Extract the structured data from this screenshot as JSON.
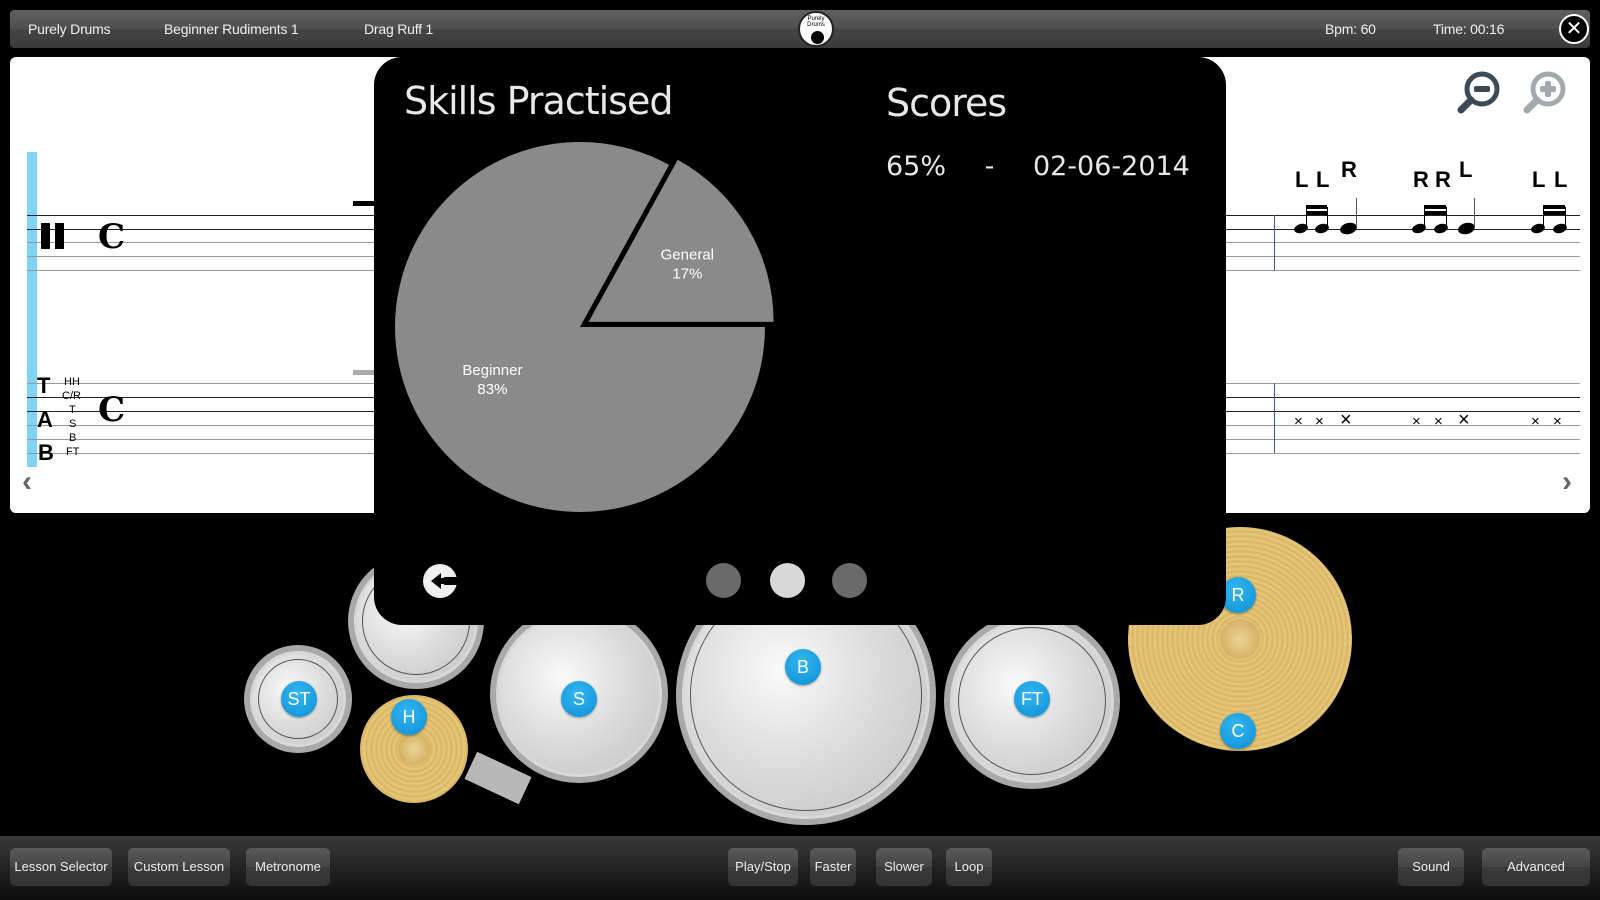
{
  "topbar": {
    "app_name": "Purely Drums",
    "lesson_group": "Beginner Rudiments 1",
    "lesson_name": "Drag Ruff 1",
    "logo_text": "Purely Drums",
    "bpm_label": "Bpm: 60",
    "time_label": "Time: 00:16",
    "close_icon": "close-icon"
  },
  "notation": {
    "tab_letters": [
      "T",
      "A",
      "B"
    ],
    "drum_labels": [
      "HH",
      "C/R",
      "T",
      "S",
      "B",
      "FT"
    ],
    "time_signature": "C",
    "sticking": [
      {
        "label": "L",
        "raised": false
      },
      {
        "label": "L",
        "raised": false
      },
      {
        "label": "R",
        "raised": true
      },
      {
        "label": "R",
        "raised": false
      },
      {
        "label": "R",
        "raised": false
      },
      {
        "label": "L",
        "raised": true
      },
      {
        "label": "L",
        "raised": false
      },
      {
        "label": "L",
        "raised": false
      }
    ],
    "tab_mark": "×",
    "zoom_out_icon": "zoom-out-icon",
    "zoom_in_icon": "zoom-in-icon",
    "prev_icon": "chevron-left-icon",
    "next_icon": "chevron-right-icon"
  },
  "dialog": {
    "skills_title": "Skills Practised",
    "scores_title": "Scores",
    "scores": [
      {
        "percent": "65%",
        "separator": "-",
        "date": "02-06-2014"
      }
    ],
    "back_icon": "back-arrow-icon",
    "pages": [
      {
        "active": false
      },
      {
        "active": true
      },
      {
        "active": false
      }
    ]
  },
  "chart_data": {
    "type": "pie",
    "title": "Skills Practised",
    "categories": [
      "Beginner",
      "General"
    ],
    "values": [
      83,
      17
    ],
    "labels": [
      "83%",
      "17%"
    ],
    "colors": [
      "#8a8a8a",
      "#8a8a8a"
    ],
    "exploded": [
      "General"
    ],
    "legend": "none"
  },
  "kit": {
    "pads": [
      {
        "key": "ST",
        "label": "ST"
      },
      {
        "key": "H",
        "label": "H"
      },
      {
        "key": "S",
        "label": "S"
      },
      {
        "key": "B",
        "label": "B"
      },
      {
        "key": "FT",
        "label": "FT"
      },
      {
        "key": "R",
        "label": "R"
      },
      {
        "key": "C",
        "label": "C"
      }
    ]
  },
  "bottombar": {
    "lesson_selector": "Lesson Selector",
    "custom_lesson": "Custom Lesson",
    "metronome": "Metronome",
    "play_stop": "Play/Stop",
    "faster": "Faster",
    "slower": "Slower",
    "loop": "Loop",
    "sound": "Sound",
    "advanced": "Advanced"
  }
}
